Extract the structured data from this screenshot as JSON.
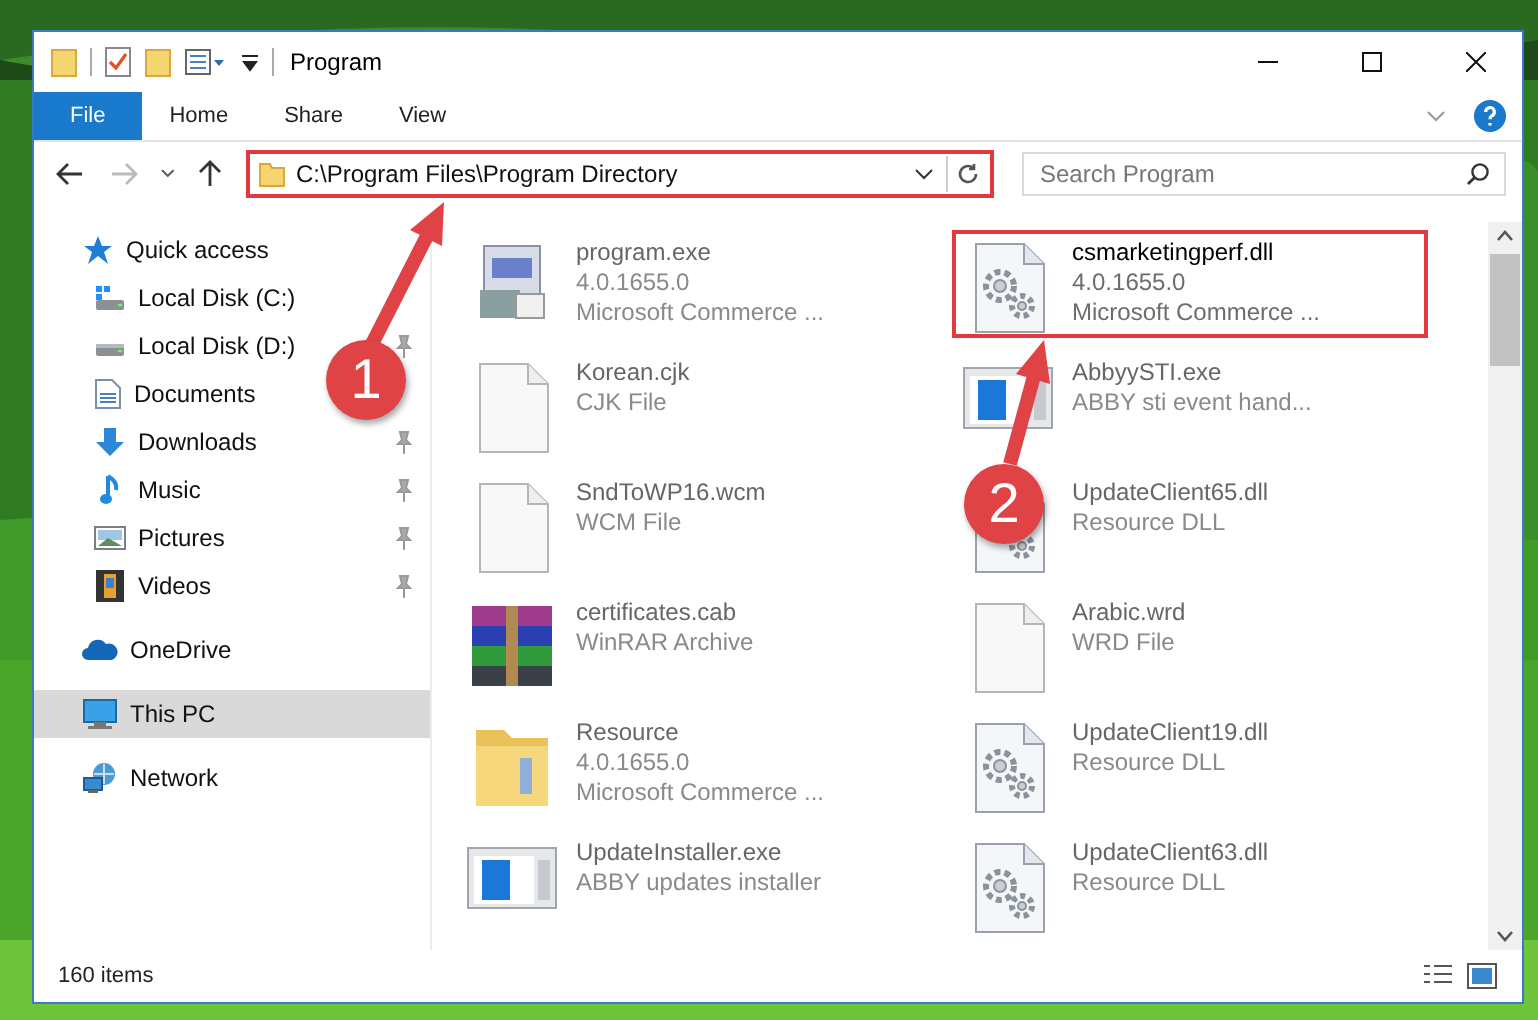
{
  "window": {
    "title": "Program"
  },
  "ribbon_tabs": [
    {
      "label": "File",
      "selected": true
    },
    {
      "label": "Home",
      "selected": false
    },
    {
      "label": "Share",
      "selected": false
    },
    {
      "label": "View",
      "selected": false
    }
  ],
  "address_bar": {
    "path": "C:\\Program Files\\Program Directory",
    "highlighted": true
  },
  "search": {
    "placeholder": "Search Program"
  },
  "nav": [
    {
      "label": "Quick access",
      "kind": "star",
      "pinned": false,
      "selected": false,
      "children": [
        {
          "label": "Local Disk (C:)",
          "kind": "drivewin",
          "pinned": false,
          "selected": false
        },
        {
          "label": "Local Disk (D:)",
          "kind": "drive",
          "pinned": true,
          "selected": false
        },
        {
          "label": "Documents",
          "kind": "document",
          "pinned": false,
          "selected": false
        },
        {
          "label": "Downloads",
          "kind": "download",
          "pinned": true,
          "selected": false
        },
        {
          "label": "Music",
          "kind": "music",
          "pinned": true,
          "selected": false
        },
        {
          "label": "Pictures",
          "kind": "picture",
          "pinned": true,
          "selected": false
        },
        {
          "label": "Videos",
          "kind": "video",
          "pinned": true,
          "selected": false
        }
      ]
    },
    {
      "label": "OneDrive",
      "kind": "cloud",
      "pinned": false,
      "selected": false
    },
    {
      "label": "This PC",
      "kind": "pc",
      "pinned": false,
      "selected": true
    },
    {
      "label": "Network",
      "kind": "network",
      "pinned": false,
      "selected": false
    }
  ],
  "files": [
    {
      "name": "program.exe",
      "details": [
        "4.0.1655.0",
        "Microsoft Commerce ..."
      ],
      "kind": "app",
      "highlighted": false
    },
    {
      "name": "csmarketingperf.dll",
      "details": [
        "4.0.1655.0",
        "Microsoft Commerce ..."
      ],
      "kind": "gear",
      "highlighted": true
    },
    {
      "name": "Korean.cjk",
      "details": [
        "CJK File"
      ],
      "kind": "blank",
      "highlighted": false
    },
    {
      "name": "AbbyySTI.exe",
      "details": [
        "ABBY sti event hand..."
      ],
      "kind": "window",
      "highlighted": false
    },
    {
      "name": "SndToWP16.wcm",
      "details": [
        "WCM File"
      ],
      "kind": "blank",
      "highlighted": false
    },
    {
      "name": "UpdateClient65.dll",
      "details": [
        "Resource DLL"
      ],
      "kind": "gear",
      "highlighted": false
    },
    {
      "name": "certificates.cab",
      "details": [
        "WinRAR Archive"
      ],
      "kind": "archive",
      "highlighted": false
    },
    {
      "name": "Arabic.wrd",
      "details": [
        "WRD File"
      ],
      "kind": "blank",
      "highlighted": false
    },
    {
      "name": "Resource",
      "details": [
        "4.0.1655.0",
        "Microsoft Commerce ..."
      ],
      "kind": "folder",
      "highlighted": false
    },
    {
      "name": "UpdateClient19.dll",
      "details": [
        "Resource DLL"
      ],
      "kind": "gear",
      "highlighted": false
    },
    {
      "name": "UpdateInstaller.exe",
      "details": [
        "ABBY updates installer"
      ],
      "kind": "window",
      "highlighted": false
    },
    {
      "name": "UpdateClient63.dll",
      "details": [
        "Resource DLL"
      ],
      "kind": "gear",
      "highlighted": false
    }
  ],
  "status_bar": {
    "item_count": "160 items"
  },
  "annotations": [
    {
      "label": "1"
    },
    {
      "label": "2"
    }
  ]
}
